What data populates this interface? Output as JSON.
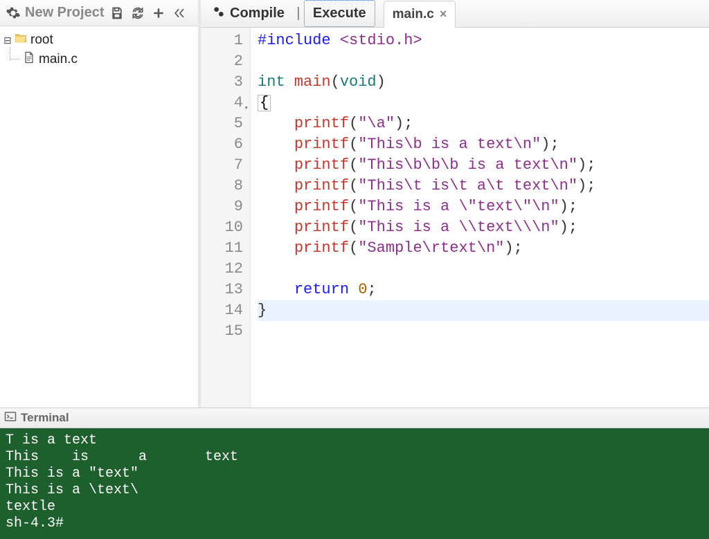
{
  "sidebar": {
    "title": "New Project",
    "tree": {
      "root_label": "root",
      "file_label": "main.c"
    }
  },
  "toolbar": {
    "compile_label": "Compile",
    "execute_label": "Execute",
    "separator": "|"
  },
  "tab": {
    "filename": "main.c",
    "close_glyph": "×"
  },
  "editor": {
    "line_numbers": [
      "1",
      "2",
      "3",
      "4",
      "5",
      "6",
      "7",
      "8",
      "9",
      "10",
      "11",
      "12",
      "13",
      "14",
      "15"
    ],
    "fold_line_index": 3,
    "highlight_line_index": 13,
    "code": {
      "l1_include": "#include",
      "l1_header": " <stdio.h>",
      "l3_int": "int",
      "l3_main": " main",
      "l3_void": "void",
      "l4_brace": "{",
      "l5_fn": "printf",
      "l5_str": "\"\\a\"",
      "l6_fn": "printf",
      "l6_str": "\"This\\b is a text\\n\"",
      "l7_fn": "printf",
      "l7_str": "\"This\\b\\b\\b is a text\\n\"",
      "l8_fn": "printf",
      "l8_str": "\"This\\t is\\t a\\t text\\n\"",
      "l9_fn": "printf",
      "l9_str": "\"This is a \\\"text\\\"\\n\"",
      "l10_fn": "printf",
      "l10_str": "\"This is a \\\\text\\\\\\n\"",
      "l11_fn": "printf",
      "l11_str": "\"Sample\\rtext\\n\"",
      "l13_return": "return",
      "l13_zero": "0",
      "l14_brace": "}"
    }
  },
  "terminal": {
    "title": "Terminal",
    "lines": [
      "T is a text",
      "This    is      a       text",
      "This is a \"text\"",
      "This is a \\text\\",
      "textle",
      "sh-4.3#"
    ]
  }
}
